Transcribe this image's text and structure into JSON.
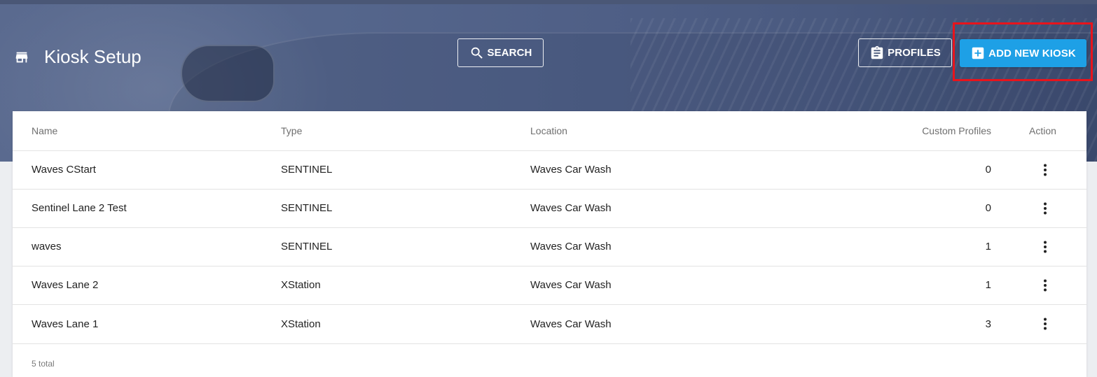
{
  "header": {
    "title": "Kiosk Setup",
    "title_icon": "store-icon"
  },
  "toolbar": {
    "search_label": "SEARCH",
    "search_icon": "search-icon",
    "profiles_label": "PROFILES",
    "profiles_icon": "clipboard-icon",
    "add_label": "ADD NEW KIOSK",
    "add_icon": "plus-box-icon"
  },
  "table": {
    "columns": [
      "Name",
      "Type",
      "Location",
      "Custom Profiles",
      "Action"
    ],
    "rows": [
      {
        "name": "Waves CStart",
        "type": "SENTINEL",
        "location": "Waves Car Wash",
        "custom_profiles": "0"
      },
      {
        "name": "Sentinel Lane 2 Test",
        "type": "SENTINEL",
        "location": "Waves Car Wash",
        "custom_profiles": "0"
      },
      {
        "name": "waves",
        "type": "SENTINEL",
        "location": "Waves Car Wash",
        "custom_profiles": "1"
      },
      {
        "name": "Waves Lane 2",
        "type": "XStation",
        "location": "Waves Car Wash",
        "custom_profiles": "1"
      },
      {
        "name": "Waves Lane 1",
        "type": "XStation",
        "location": "Waves Car Wash",
        "custom_profiles": "3"
      }
    ],
    "footer": "5 total"
  },
  "colors": {
    "accent": "#1ea0e6",
    "highlight": "#e8141c",
    "header_bg": "#55668c"
  }
}
